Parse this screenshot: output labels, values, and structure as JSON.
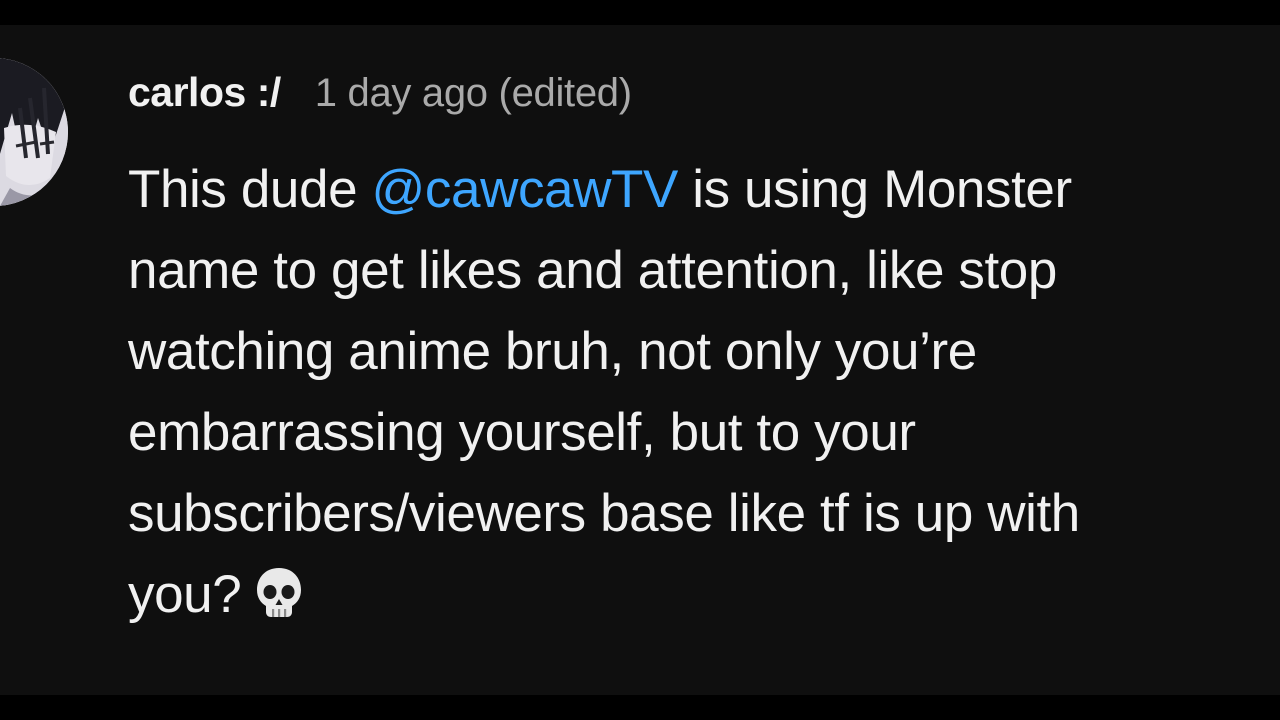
{
  "comment": {
    "author": "carlos :/",
    "timestamp": "1 day ago (edited)",
    "lines": [
      {
        "before": "This dude ",
        "mention": "@cawcawTV",
        "after": " is using Monster"
      },
      {
        "text": "name to get likes and attention, like stop"
      },
      {
        "text": "watching anime bruh, not only you’re"
      },
      {
        "text": "embarrassing yourself, but to your"
      },
      {
        "text": "subscribers/viewers base like tf is up with"
      },
      {
        "text": "you?",
        "emoji": "skull-icon"
      }
    ]
  },
  "colors": {
    "background": "#0f0f0f",
    "letterbox": "#000000",
    "author_text": "#f1f1f1",
    "timestamp_text": "#aaaaaa",
    "body_text": "#f1f1f1",
    "mention_link": "#3ea6ff"
  }
}
